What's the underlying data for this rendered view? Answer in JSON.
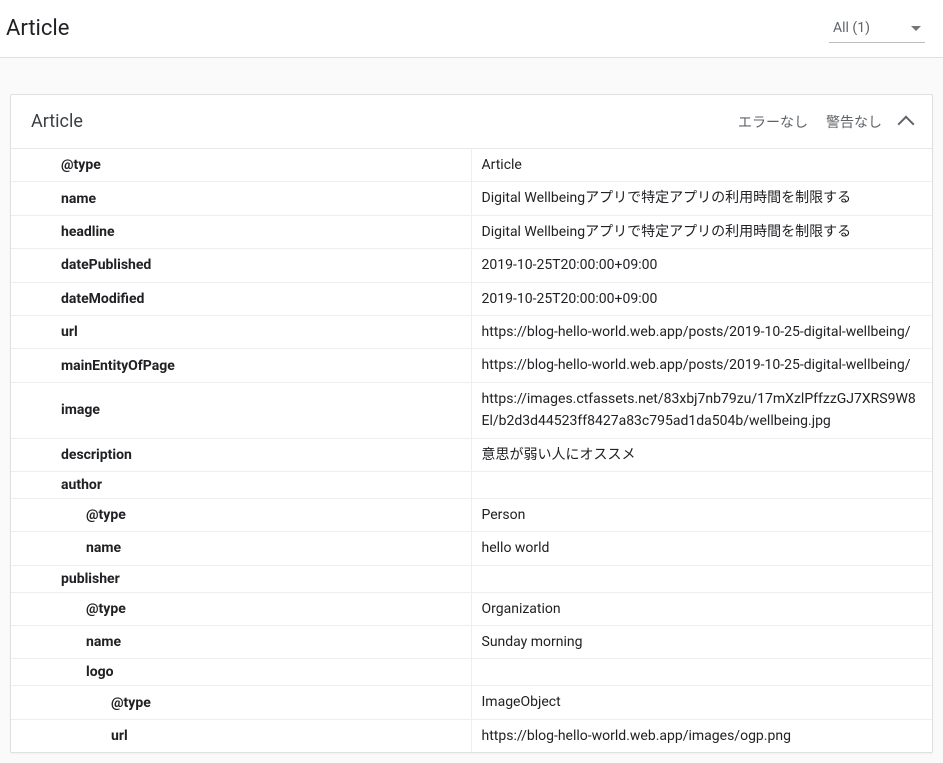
{
  "header": {
    "title": "Article",
    "filter_label": "All (1)"
  },
  "card": {
    "title": "Article",
    "status_errors": "エラーなし",
    "status_warnings": "警告なし"
  },
  "rows": {
    "r0_key": "@type",
    "r0_val": "Article",
    "r1_key": "name",
    "r1_val": "Digital Wellbeingアプリで特定アプリの利用時間を制限する",
    "r2_key": "headline",
    "r2_val": "Digital Wellbeingアプリで特定アプリの利用時間を制限する",
    "r3_key": "datePublished",
    "r3_val": "2019-10-25T20:00:00+09:00",
    "r4_key": "dateModified",
    "r4_val": "2019-10-25T20:00:00+09:00",
    "r5_key": "url",
    "r5_val": "https://blog-hello-world.web.app/posts/2019-10-25-digital-wellbeing/",
    "r6_key": "mainEntityOfPage",
    "r6_val": "https://blog-hello-world.web.app/posts/2019-10-25-digital-wellbeing/",
    "r7_key": "image",
    "r7_val": "https://images.ctfassets.net/83xbj7nb79zu/17mXzlPffzzGJ7XRS9W8El/b2d3d44523ff8427a83c795ad1da504b/wellbeing.jpg",
    "r8_key": "description",
    "r8_val": "意思が弱い人にオススメ",
    "r9_key": "author",
    "r10_key": "@type",
    "r10_val": "Person",
    "r11_key": "name",
    "r11_val": "hello world",
    "r12_key": "publisher",
    "r13_key": "@type",
    "r13_val": "Organization",
    "r14_key": "name",
    "r14_val": "Sunday morning",
    "r15_key": "logo",
    "r16_key": "@type",
    "r16_val": "ImageObject",
    "r17_key": "url",
    "r17_val": "https://blog-hello-world.web.app/images/ogp.png"
  }
}
